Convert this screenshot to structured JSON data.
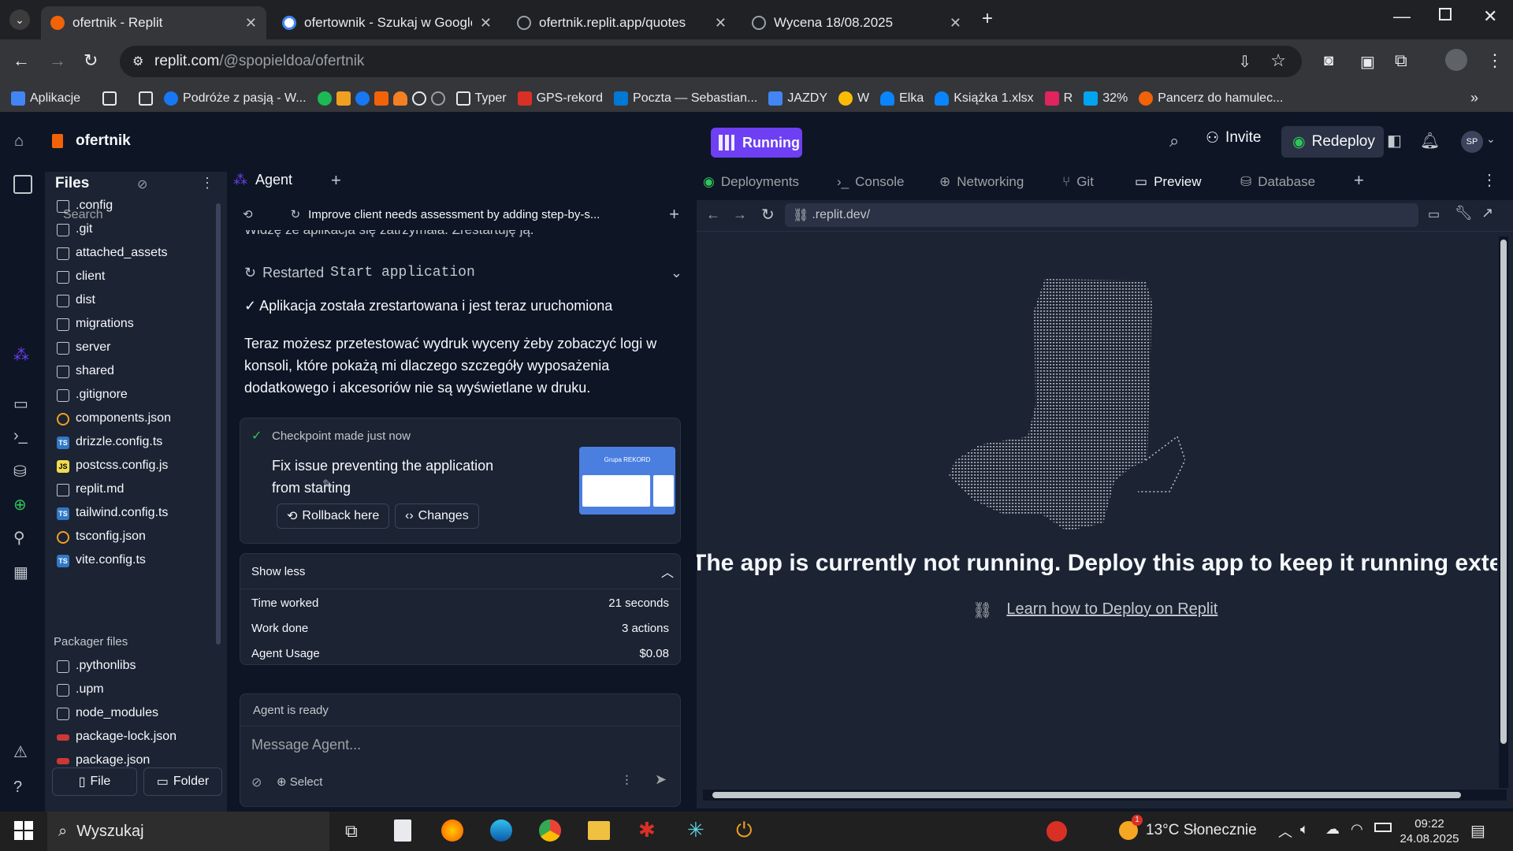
{
  "browser": {
    "tabs": [
      {
        "title": "ofertnik - Replit",
        "active": true,
        "color": "#f26207"
      },
      {
        "title": "ofertownik - Szukaj w Google",
        "active": false,
        "color": "#ffffff"
      },
      {
        "title": "ofertnik.replit.app/quotes",
        "active": false,
        "color": "#9aa0a6"
      },
      {
        "title": "Wycena 18/08.2025",
        "active": false,
        "color": "#9aa0a6"
      }
    ],
    "url_host": "replit.com",
    "url_path": "/@spopieldoa/ofertnik",
    "bookmarks": [
      "Aplikacje",
      "Podróże z pasją - W...",
      "Typer",
      "GPS-rekord",
      "Poczta — Sebastian...",
      "JAZDY",
      "W",
      "Elka",
      "Książka 1.xlsx",
      "R",
      "32%",
      "Pancerz do hamulec..."
    ]
  },
  "replit": {
    "project_name": "ofertnik",
    "run_status": "Running",
    "invite_label": "Invite",
    "redeploy_label": "Redeploy",
    "avatar": "SP",
    "files": {
      "title": "Files",
      "search_placeholder": "Search",
      "items": [
        ".config",
        ".git",
        "attached_assets",
        "client",
        "dist",
        "migrations",
        "server",
        "shared",
        ".gitignore",
        "components.json",
        "drizzle.config.ts",
        "postcss.config.js",
        "replit.md",
        "tailwind.config.ts",
        "tsconfig.json",
        "vite.config.ts"
      ],
      "packager_title": "Packager files",
      "packager_items": [
        ".pythonlibs",
        ".upm",
        "node_modules",
        "package-lock.json",
        "package.json"
      ],
      "file_btn": "File",
      "folder_btn": "Folder"
    },
    "agent": {
      "tab_label": "Agent",
      "task_title": "Improve client needs assessment by adding step-by-s...",
      "truncated_line": "Widzę że aplikacja się zatrzymała. Zrestartuję ją.",
      "restarted_prefix": "Restarted",
      "restarted_cmd": "Start application",
      "confirm": "✓ Aplikacja została zrestartowana i jest teraz uruchomiona",
      "message": "Teraz możesz przetestować wydruk wyceny żeby zobaczyć logi w konsoli, które pokażą mi dlaczego szczegóły wyposażenia dodatkowego i akcesoriów nie są wyświetlane w druku.",
      "checkpoint_label": "Checkpoint made just now",
      "checkpoint_title": "Fix issue preventing the application from starting",
      "thumb_text": "Grupa REKORD",
      "rollback_label": "Rollback here",
      "changes_label": "Changes",
      "show_less": "Show less",
      "stats": [
        {
          "label": "Time worked",
          "value": "21 seconds"
        },
        {
          "label": "Work done",
          "value": "3 actions"
        },
        {
          "label": "Agent Usage",
          "value": "$0.08"
        }
      ],
      "status": "Agent is ready",
      "input_placeholder": "Message Agent...",
      "select_label": "Select"
    },
    "pane_tabs": [
      "Deployments",
      "Console",
      "Networking",
      "Git",
      "Preview",
      "Database"
    ],
    "preview": {
      "url": ".replit.dev/",
      "message": "The app is currently not running. Deploy this app to keep it running externally.",
      "link": "Learn how to Deploy on Replit"
    }
  },
  "taskbar": {
    "search_placeholder": "Wyszukaj",
    "weather": "13°C Słonecznie",
    "time": "09:22",
    "date": "24.08.2025",
    "weather_badge": "1"
  }
}
